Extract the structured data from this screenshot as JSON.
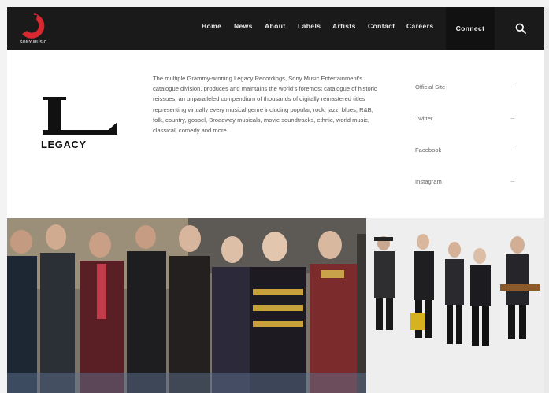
{
  "brand": {
    "name": "SONY MUSIC",
    "accent": "#d7282f",
    "header_bg": "#1a1a1a"
  },
  "nav": {
    "items": [
      {
        "label": "Home"
      },
      {
        "label": "News"
      },
      {
        "label": "About"
      },
      {
        "label": "Labels"
      },
      {
        "label": "Artists"
      },
      {
        "label": "Contact"
      },
      {
        "label": "Careers"
      }
    ],
    "connect_label": "Connect",
    "search_icon": "search-icon"
  },
  "label": {
    "logo_letter": "L",
    "logo_word": "LEGACY",
    "description": "The multiple Grammy-winning Legacy Recordings, Sony Music Entertainment's catalogue division, produces and maintains the world's foremost catalogue of historic reissues, an unparalleled compendium of thousands of digitally remastered titles representing virtually every musical genre including popular, rock, jazz, blues, R&B, folk, country, gospel, Broadway musicals, movie soundtracks, ethnic, world music, classical, comedy and more."
  },
  "links": [
    {
      "label": "Official Site",
      "icon": "arrow-right-icon"
    },
    {
      "label": "Twitter",
      "icon": "arrow-right-icon"
    },
    {
      "label": "Facebook",
      "icon": "arrow-right-icon"
    },
    {
      "label": "Instagram",
      "icon": "arrow-right-icon"
    }
  ]
}
